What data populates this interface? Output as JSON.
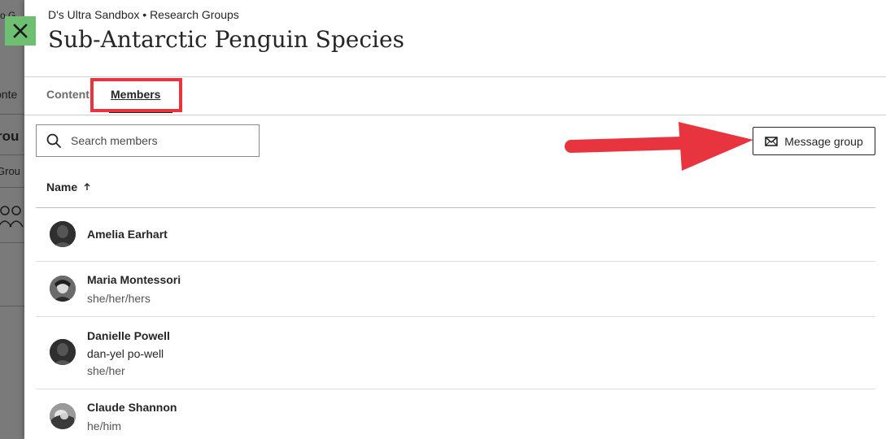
{
  "background": {
    "fragments": [
      "o G",
      "onte",
      "rou",
      "Grou"
    ]
  },
  "close_label": "×",
  "breadcrumb": "D's Ultra Sandbox • Research Groups",
  "title": "Sub-Antarctic Penguin Species",
  "tabs": [
    {
      "label": "Content"
    },
    {
      "label": "Members",
      "selected": true
    }
  ],
  "search": {
    "placeholder": "Search members"
  },
  "message_button": {
    "label": "Message group"
  },
  "table": {
    "column_name": "Name",
    "sort": "ascending"
  },
  "members": [
    {
      "name": "Amelia Earhart",
      "lines": []
    },
    {
      "name": "Maria Montessori",
      "lines": [
        "she/her/hers"
      ]
    },
    {
      "name": "Danielle Powell",
      "lines": [
        "dan-yel po-well",
        "she/her"
      ]
    },
    {
      "name": "Claude Shannon",
      "lines": [
        "he/him"
      ]
    }
  ],
  "colors": {
    "accent_highlight": "#e8343f",
    "close_button": "#6fbf73"
  }
}
